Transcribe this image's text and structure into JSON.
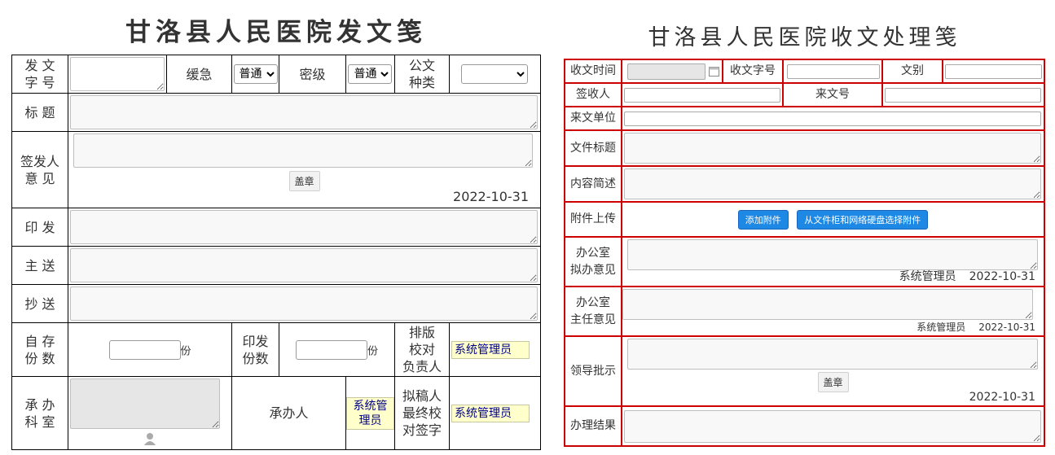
{
  "left": {
    "title": "甘洛县人民医院发文笺",
    "labels": {
      "doc_no": [
        "发 文",
        "字 号"
      ],
      "urgency": "缓急",
      "secret": "密级",
      "doc_type": [
        "公文",
        "种类"
      ],
      "subject": "标 题",
      "signer": [
        "签发人",
        "意 见"
      ],
      "print": "印 发",
      "main_send": "主 送",
      "cc": "抄 送",
      "self_keep": [
        "自 存",
        "份 数"
      ],
      "print_copies": [
        "印发",
        "份数"
      ],
      "typeset": [
        "排版",
        "校对",
        "负责人"
      ],
      "dept": [
        "承 办",
        "科 室"
      ],
      "handler": "承办人",
      "drafter": [
        "拟稿人",
        "最终校",
        "对签字"
      ]
    },
    "urgency_value": "普通",
    "secret_value": "普通",
    "doc_type_value": "",
    "stamp_button": "盖章",
    "signer_date": "2022-10-31",
    "unit": "份",
    "typeset_person": "系统管理员",
    "handler_person": "系统管理员",
    "drafter_person": "系统管理员"
  },
  "right": {
    "title": "甘洛县人民医院收文处理笺",
    "labels": {
      "recv_time": "收文时间",
      "recv_no": "收文字号",
      "doc_cat": "文别",
      "receiver": "签收人",
      "incoming_no": "来文号",
      "from_unit": "来文单位",
      "doc_title": "文件标题",
      "summary": "内容简述",
      "attach": "附件上传",
      "office_opinion": [
        "办公室",
        "拟办意见"
      ],
      "director_opinion": [
        "办公室",
        "主任意见"
      ],
      "leader": "领导批示",
      "result": "办理结果"
    },
    "add_attach_button": "添加附件",
    "choose_attach_button": "从文件柜和网络硬盘选择附件",
    "office_person": "系统管理员",
    "office_date": "2022-10-31",
    "director_person": "系统管理员",
    "director_date": "2022-10-31",
    "stamp_button": "盖章",
    "leader_date": "2022-10-31"
  }
}
